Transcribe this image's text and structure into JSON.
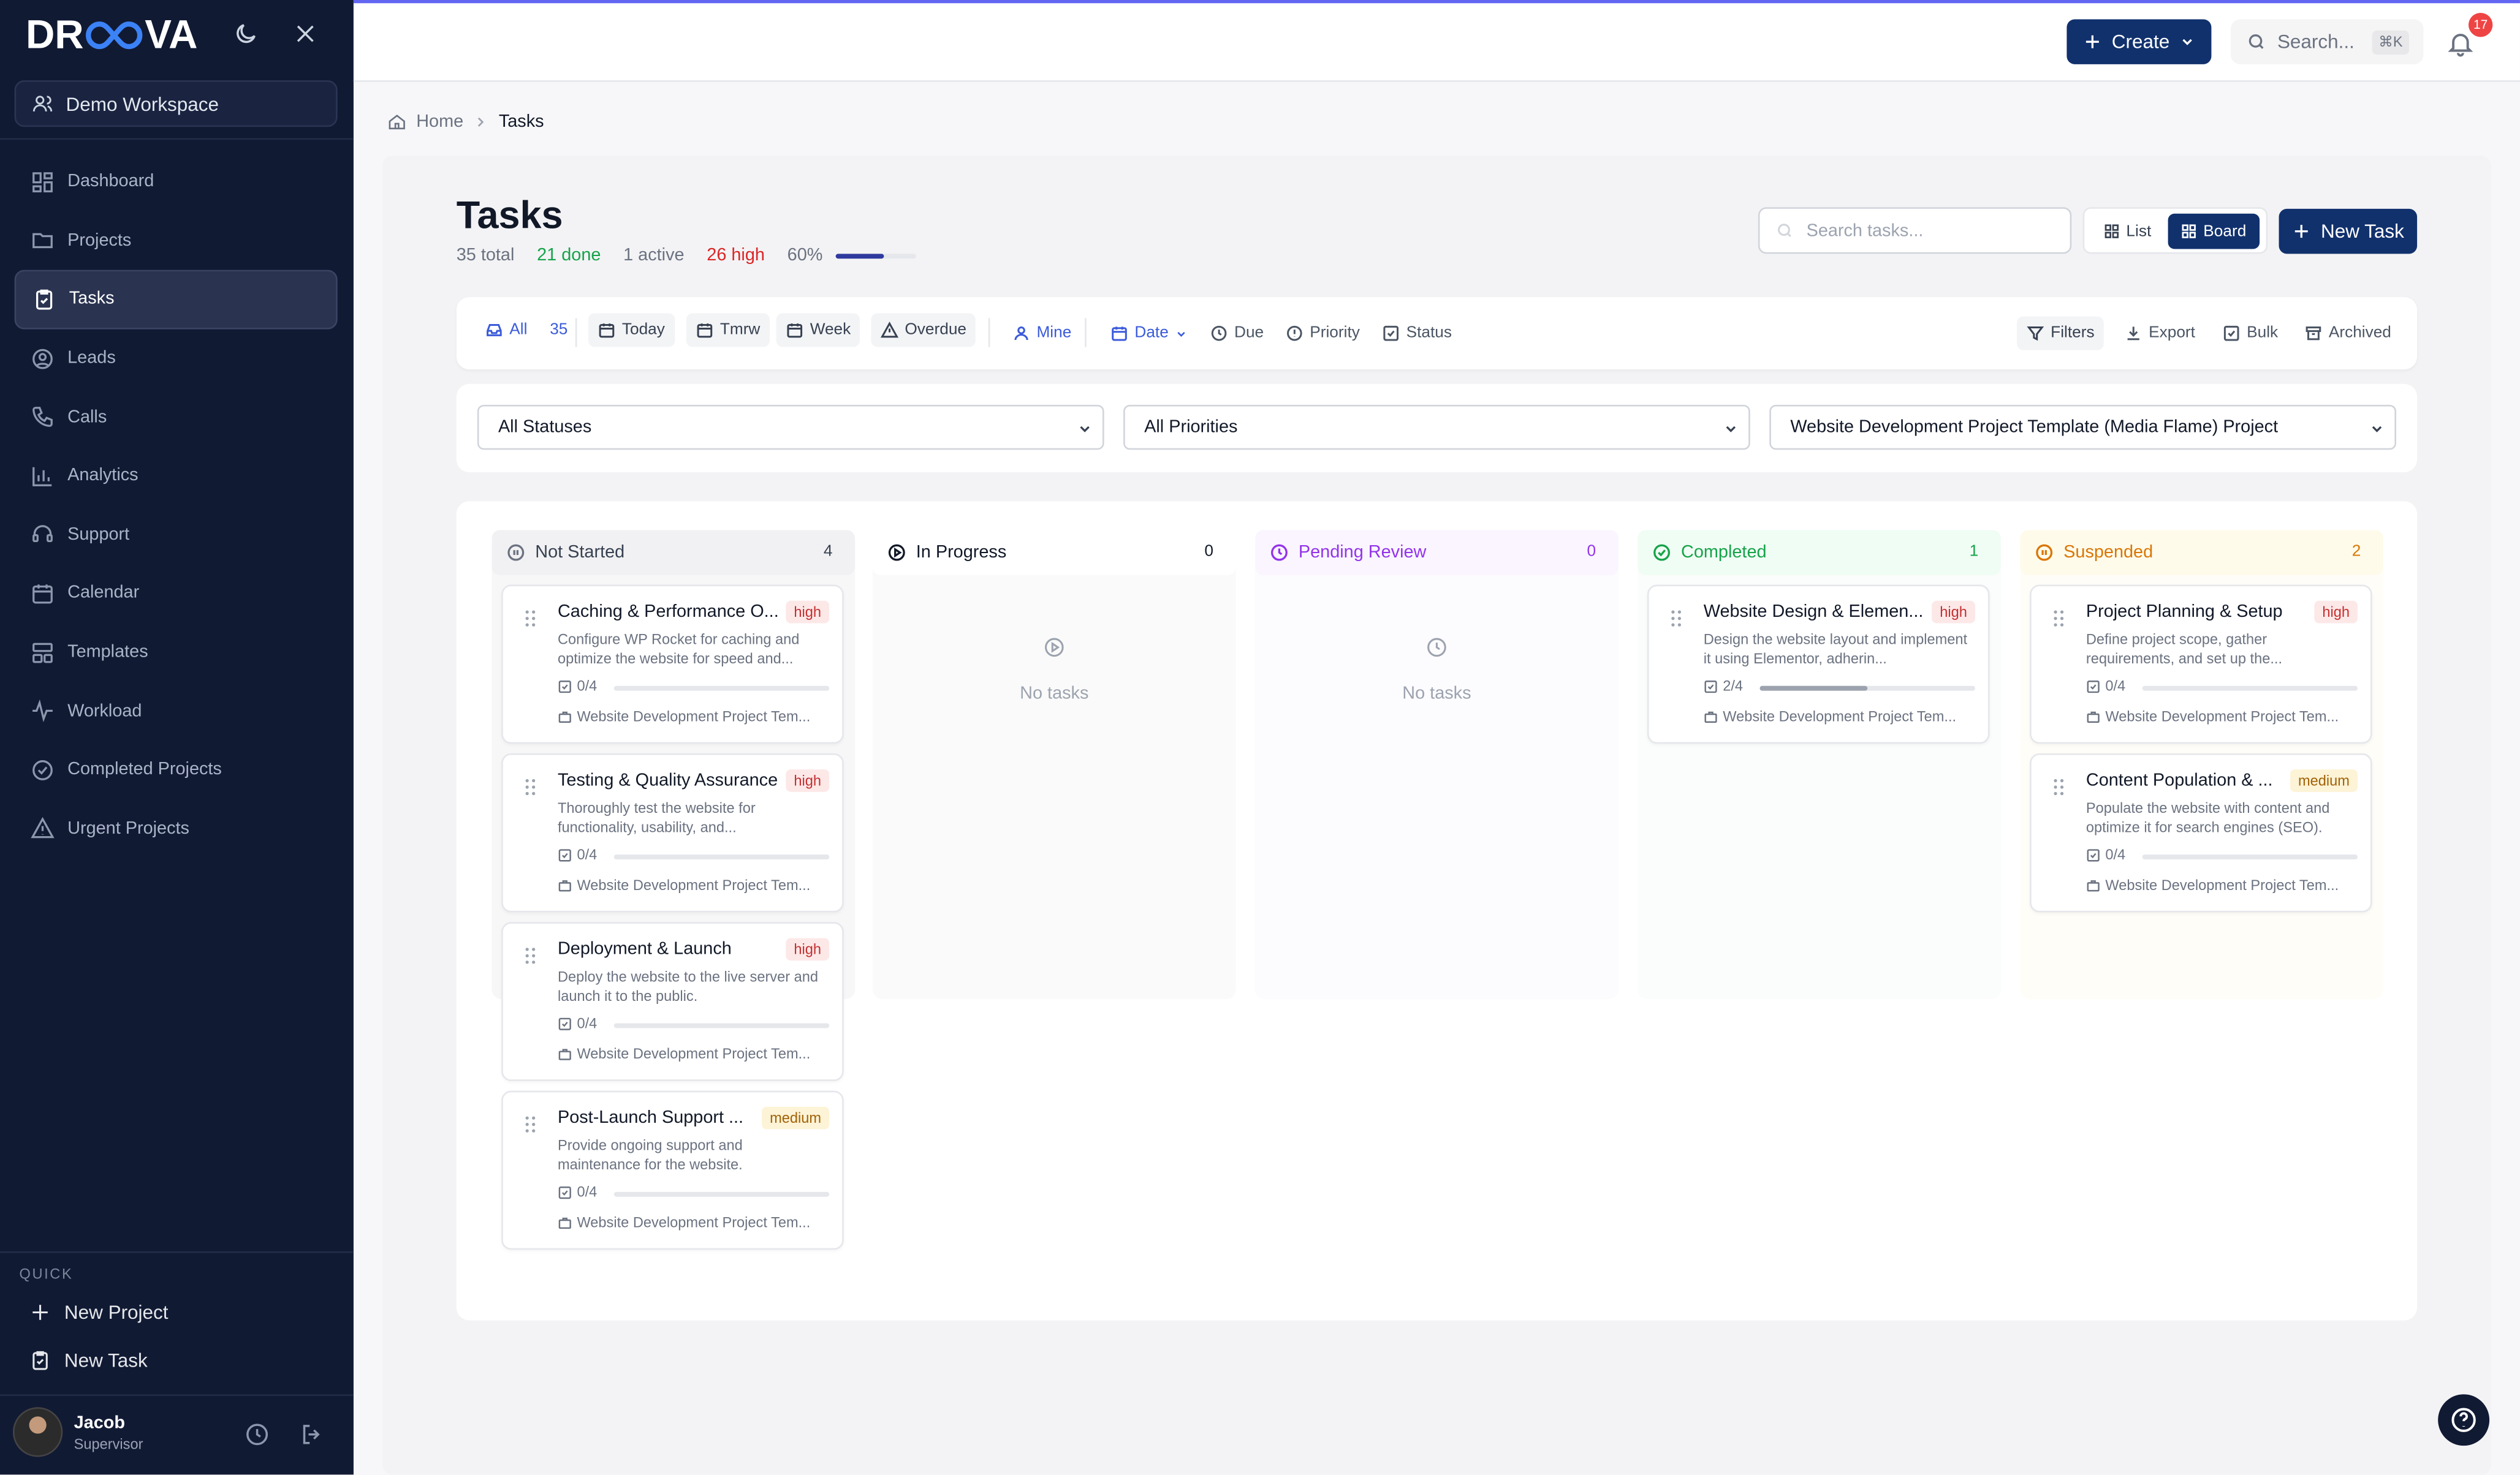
{
  "brand": {
    "logo_left": "DR",
    "logo_right": "VA"
  },
  "workspace": {
    "name": "Demo Workspace"
  },
  "sidebar": {
    "items": [
      {
        "label": "Dashboard",
        "icon": "dashboard-icon"
      },
      {
        "label": "Projects",
        "icon": "folder-icon"
      },
      {
        "label": "Tasks",
        "icon": "clipboard-check-icon",
        "active": true
      },
      {
        "label": "Leads",
        "icon": "user-circle-icon"
      },
      {
        "label": "Calls",
        "icon": "phone-icon"
      },
      {
        "label": "Analytics",
        "icon": "bar-chart-icon"
      },
      {
        "label": "Support",
        "icon": "headset-icon"
      },
      {
        "label": "Calendar",
        "icon": "calendar-icon"
      },
      {
        "label": "Templates",
        "icon": "templates-icon"
      },
      {
        "label": "Workload",
        "icon": "activity-icon"
      },
      {
        "label": "Completed Projects",
        "icon": "check-circle-icon"
      },
      {
        "label": "Urgent Projects",
        "icon": "warning-icon"
      }
    ],
    "quick_label": "QUICK",
    "quick_new_project": "New Project",
    "quick_new_task": "New Task",
    "user_name": "Jacob",
    "user_role": "Supervisor"
  },
  "header": {
    "create_label": "Create",
    "search_placeholder": "Search...",
    "search_shortcut": "⌘K",
    "notifications_count": "17"
  },
  "breadcrumb": {
    "home": "Home",
    "current": "Tasks"
  },
  "page": {
    "title": "Tasks",
    "stats": {
      "total": "35 total",
      "done": "21 done",
      "active": "1 active",
      "high": "26 high",
      "percent": "60%",
      "progress_fraction": 0.6
    },
    "search_placeholder": "Search tasks...",
    "view_list": "List",
    "view_board": "Board",
    "new_task": "New Task"
  },
  "filters": {
    "all": "All",
    "all_count": "35",
    "today": "Today",
    "tmrw": "Tmrw",
    "week": "Week",
    "overdue": "Overdue",
    "mine": "Mine",
    "date": "Date",
    "due": "Due",
    "priority": "Priority",
    "status": "Status",
    "filters": "Filters",
    "export": "Export",
    "bulk": "Bulk",
    "archived": "Archived"
  },
  "dropdowns": {
    "status": "All Statuses",
    "priority": "All Priorities",
    "project": "Website Development Project Template (Media Flame) Project"
  },
  "board": {
    "no_tasks": "No tasks",
    "columns": [
      {
        "name": "Not Started",
        "count": "4",
        "color": "#4b5563",
        "bg": "#f3f4f6"
      },
      {
        "name": "In Progress",
        "count": "0",
        "color": "#111827",
        "bg": "#ffffff"
      },
      {
        "name": "Pending Review",
        "count": "0",
        "color": "#9333ea",
        "bg": "#faf5ff"
      },
      {
        "name": "Completed",
        "count": "1",
        "color": "#16a34a",
        "bg": "#f0fdf4"
      },
      {
        "name": "Suspended",
        "count": "2",
        "color": "#d97706",
        "bg": "#fffbeb"
      }
    ],
    "cards": {
      "c1": {
        "title": "Caching & Performance O...",
        "priority": "high",
        "desc": "Configure WP Rocket for caching and optimize the website for speed and...",
        "checklist": "0/4",
        "progress": 0,
        "project": "Website Development Project Tem..."
      },
      "c2": {
        "title": "Testing & Quality Assurance",
        "priority": "high",
        "desc": "Thoroughly test the website for functionality, usability, and...",
        "checklist": "0/4",
        "progress": 0,
        "project": "Website Development Project Tem..."
      },
      "c3": {
        "title": "Deployment & Launch",
        "priority": "high",
        "desc": "Deploy the website to the live server and launch it to the public.",
        "checklist": "0/4",
        "progress": 0,
        "project": "Website Development Project Tem..."
      },
      "c4": {
        "title": "Post-Launch Support ...",
        "priority": "medium",
        "desc": "Provide ongoing support and maintenance for the website.",
        "checklist": "0/4",
        "progress": 0,
        "project": "Website Development Project Tem..."
      },
      "c5": {
        "title": "Website Design & Elemen...",
        "priority": "high",
        "desc": "Design the website layout and implement it using Elementor, adherin...",
        "checklist": "2/4",
        "progress": 0.5,
        "project": "Website Development Project Tem..."
      },
      "c6": {
        "title": "Project Planning & Setup",
        "priority": "high",
        "desc": "Define project scope, gather requirements, and set up the...",
        "checklist": "0/4",
        "progress": 0,
        "project": "Website Development Project Tem..."
      },
      "c7": {
        "title": "Content Population & ...",
        "priority": "medium",
        "desc": "Populate the website with content and optimize it for search engines (SEO).",
        "checklist": "0/4",
        "progress": 0,
        "project": "Website Development Project Tem..."
      }
    }
  }
}
